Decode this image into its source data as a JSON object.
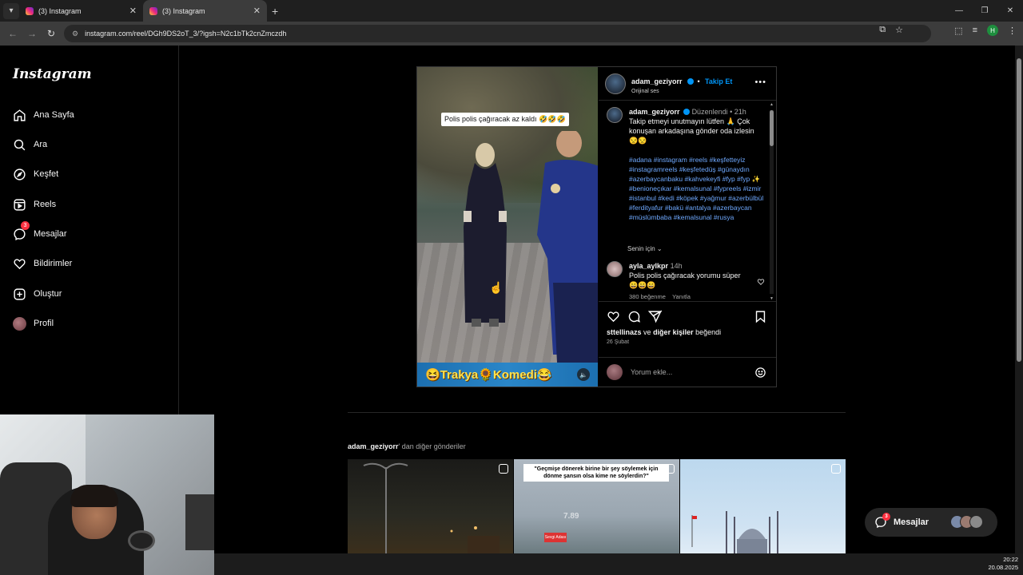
{
  "browser": {
    "tabs": [
      {
        "title": "(3) Instagram",
        "active": false
      },
      {
        "title": "(3) Instagram",
        "active": true
      }
    ],
    "url": "instagram.com/reel/DGh9DS2oT_3/?igsh=N2c1bTk2cnZmczdh",
    "profile_initial": "H"
  },
  "sidebar": {
    "logo": "Instagram",
    "items": [
      {
        "label": "Ana Sayfa",
        "icon": "home-icon"
      },
      {
        "label": "Ara",
        "icon": "search-icon"
      },
      {
        "label": "Keşfet",
        "icon": "compass-icon"
      },
      {
        "label": "Reels",
        "icon": "reels-icon"
      },
      {
        "label": "Mesajlar",
        "icon": "messenger-icon",
        "badge": "3"
      },
      {
        "label": "Bildirimler",
        "icon": "heart-icon"
      },
      {
        "label": "Oluştur",
        "icon": "plus-square-icon"
      },
      {
        "label": "Profil",
        "icon": "profile-avatar"
      }
    ]
  },
  "post": {
    "video_caption": "Polis polis çağıracak az kaldı 🤣🤣🤣",
    "video_banner": "😆Trakya🌻Komedi😂",
    "author": "adam_geziyorr",
    "follow_label": "Takip Et",
    "audio": "Orijinal ses",
    "caption": {
      "author": "adam_geziyorr",
      "edited": "Düzenlendi",
      "time": "21h",
      "text": "Takip etmeyi unutmayın lütfen 🙏 Çok konuşan arkadaşına gönder oda izlesin 😒😒",
      "hashtags": "#adana #instagram #reels #keşfetteyiz #instagramreels #keşfetedüş #günaydın #azerbaycanbaku #kahvekeyfi #fyp #fyp ✨ #benioneçıkar #kemalsunal #fypreels #izmir #istanbul #kedi #köpek #yağmur #azerbülbül #ferdityafur #bakü #antalya #azerbaycan #müslümbaba #kemalsunal #rusya"
    },
    "for_you": "Senin için",
    "comment": {
      "author": "ayla_aylkpr",
      "time": "14h",
      "text": "Polis polis çağıracak yorumu süper 😄😄😄",
      "likes": "380 beğenme",
      "reply": "Yanıtla"
    },
    "likes_user": "sttellinazs",
    "likes_and": "ve",
    "likes_others": "diğer kişiler",
    "likes_suffix": "beğendi",
    "date": "26 Şubat",
    "comment_placeholder": "Yorum ekle..."
  },
  "more_posts": {
    "author": "adam_geziyorr",
    "suffix": "' dan diğer gönderiler",
    "thumb2_caption": "\"Geçmişe dönerek birine bir şey söylemek için dönme şansın olsa kime ne söylerdin?\"",
    "thumb2_watermark": "7.89",
    "thumb2_sign": "Sevgi Adası"
  },
  "float_messages": {
    "label": "Mesajlar",
    "badge": "3"
  },
  "clock": {
    "time": "20:22",
    "date": "20.08.2025"
  },
  "colors": {
    "accent": "#0095f6",
    "badge": "#ff3040",
    "banner": "#2a86c8"
  }
}
